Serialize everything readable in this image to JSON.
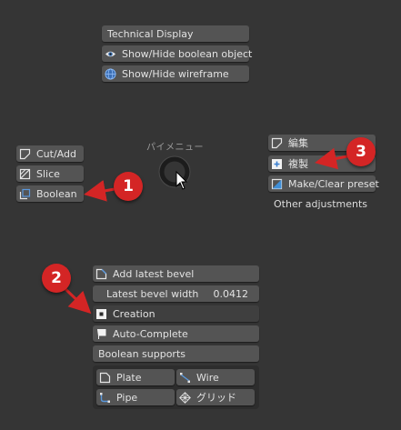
{
  "colors": {
    "background": "#353535",
    "button": "#545454",
    "button_active": "#3f3f3f",
    "panel": "#2d2d2d",
    "accent_blue": "#5a98dc",
    "callout_red": "#d42525"
  },
  "top_menu": {
    "technical_display": "Technical Display",
    "show_hide_boolean": "Show/Hide boolean object",
    "show_hide_boolean_icon": "eye-icon",
    "show_hide_wireframe": "Show/Hide wireframe",
    "show_hide_wireframe_icon": "globe-icon"
  },
  "pie_title": "パイメニュー",
  "left_menu": {
    "cut_add": "Cut/Add",
    "slice": "Slice",
    "boolean": "Boolean"
  },
  "right_menu": {
    "edit": "編集",
    "duplicate": "複製",
    "make_clear_preset": "Make/Clear preset",
    "other_adjustments": "Other adjustments"
  },
  "bottom_menu": {
    "add_latest_bevel": "Add latest bevel",
    "latest_bevel_width_label": "Latest bevel width",
    "latest_bevel_width_value": "0.0412",
    "creation": "Creation",
    "auto_complete": "Auto-Complete",
    "boolean_supports": "Boolean supports",
    "plate": "Plate",
    "wire": "Wire",
    "pipe": "Pipe",
    "grid": "グリッド"
  },
  "callouts": {
    "one": "1",
    "two": "2",
    "three": "3"
  }
}
